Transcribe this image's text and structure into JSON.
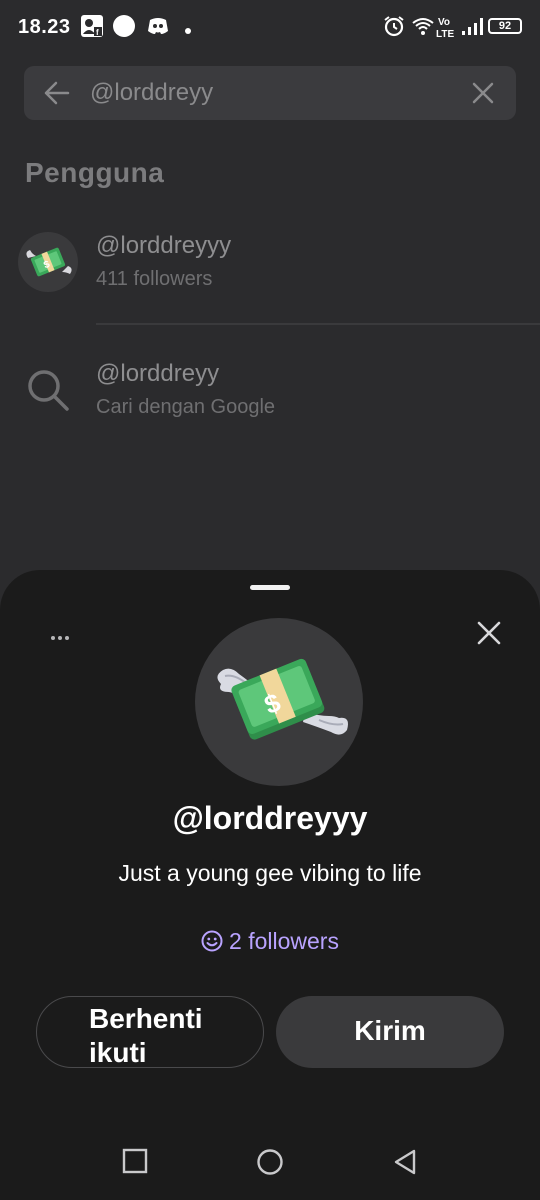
{
  "status_bar": {
    "time": "18.23",
    "battery": "92",
    "icons": [
      "contact-card-icon",
      "circle-icon",
      "discord-icon",
      "dot-icon",
      "alarm-icon",
      "wifi-icon",
      "volte-icon",
      "signal-icon",
      "battery-icon"
    ]
  },
  "search": {
    "value": "@lorddreyy",
    "back_icon": "arrow-left-icon",
    "clear_icon": "close-icon"
  },
  "results": {
    "section_title": "Pengguna",
    "items": [
      {
        "title": "@lorddreyyy",
        "subtitle": "411 followers",
        "icon": "money-with-wings-avatar"
      },
      {
        "title": "@lorddreyy",
        "subtitle": "Cari dengan Google",
        "icon": "search-icon"
      }
    ]
  },
  "profile_sheet": {
    "more_icon": "more-horizontal-icon",
    "close_icon": "close-icon",
    "avatar_icon": "money-with-wings-icon",
    "username": "@lorddreyyy",
    "bio": "Just a young gee vibing to life",
    "followers_text": "2 followers",
    "unfollow_label": "Berhenti ikuti",
    "send_label": "Kirim",
    "accent_color": "#b9a3ff"
  },
  "navbar": {
    "items": [
      "recents-square-icon",
      "home-circle-icon",
      "back-triangle-icon"
    ]
  }
}
